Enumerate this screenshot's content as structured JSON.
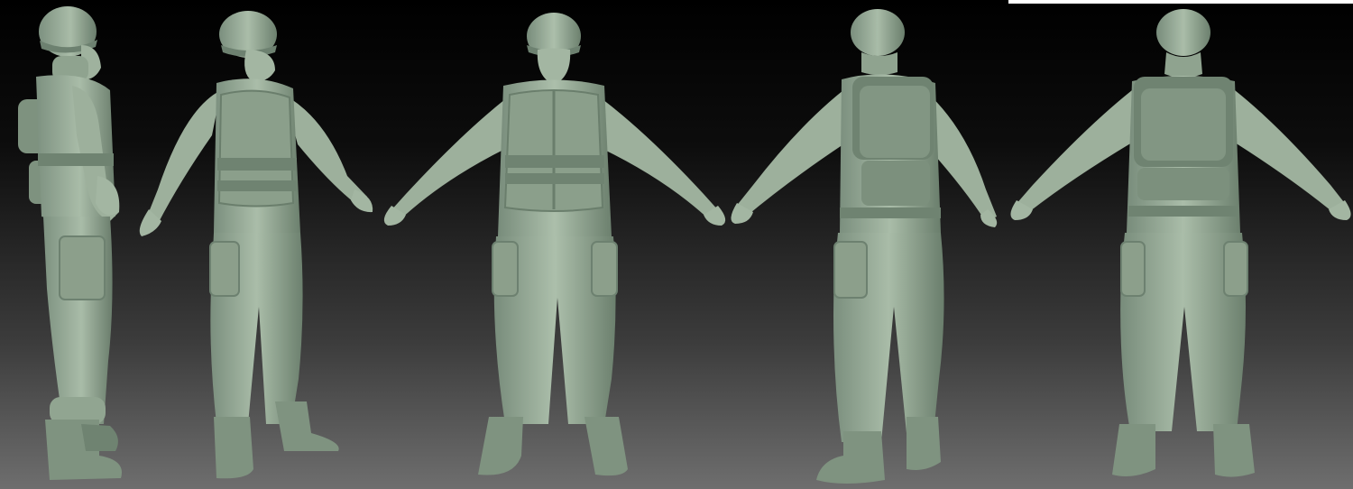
{
  "scene": {
    "subject": "soldier-sculpt",
    "material_color": "#a7bba6",
    "material_shadow": "#6f8471",
    "material_dark": "#56685a",
    "views": [
      {
        "id": "side-left",
        "facing": "left-profile"
      },
      {
        "id": "three-quarter-front",
        "facing": "front-right"
      },
      {
        "id": "front",
        "facing": "front"
      },
      {
        "id": "three-quarter-back",
        "facing": "back-left"
      },
      {
        "id": "back",
        "facing": "back"
      }
    ]
  }
}
